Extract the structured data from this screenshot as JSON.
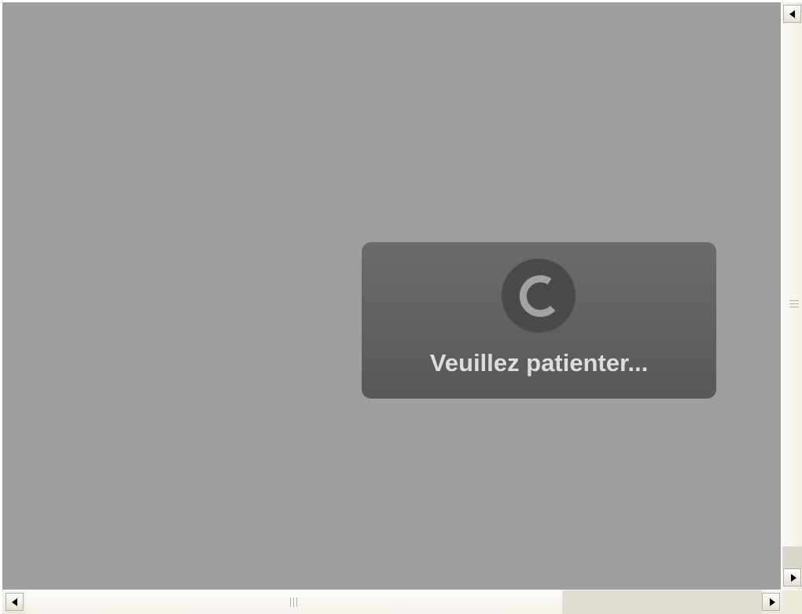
{
  "overlay": {
    "color": "#9e9e9e"
  },
  "loading": {
    "message": "Veuillez patienter...",
    "icon": "spinner-icon",
    "box_color": "#626262",
    "text_color": "#dddddd"
  },
  "scrollbars": {
    "vertical": {
      "up_icon": "arrow-left-icon",
      "down_icon": "arrow-right-icon",
      "grip_icon": "grip-lines-icon"
    },
    "horizontal": {
      "left_icon": "arrow-left-icon",
      "right_icon": "arrow-right-icon",
      "grip_icon": "grip-lines-icon"
    }
  }
}
